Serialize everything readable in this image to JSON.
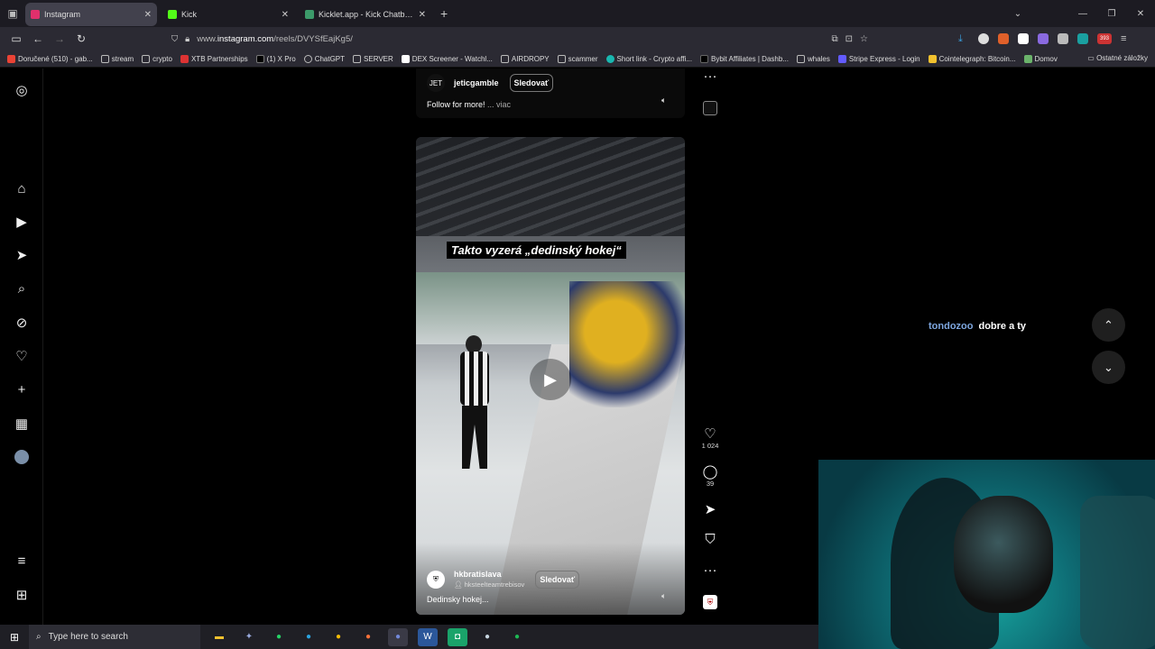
{
  "browser": {
    "tabs": [
      {
        "title": "Instagram",
        "active": true,
        "color": "#e1306c"
      },
      {
        "title": "Kick",
        "active": false,
        "color": "#53fc18"
      },
      {
        "title": "Kicklet.app - Kick Chatbot and C",
        "active": false,
        "color": "#3c9a6a"
      }
    ],
    "url_prefix": "www.",
    "url_host": "instagram.com",
    "url_path": "/reels/DVYSfEajKg5/",
    "extension_badge": "393"
  },
  "bookmarks": {
    "items": [
      "Doručené (510) - gab...",
      "stream",
      "crypto",
      "XTB Partnerships",
      "(1) X Pro",
      "ChatGPT",
      "SERVER",
      "DEX Screener - Watchl...",
      "AIRDROPY",
      "scammer",
      "Short link - Crypto affi...",
      "Bybit Affiliates | Dashb...",
      "whales",
      "Stripe Express - Login",
      "Cointelegraph: Bitcoin...",
      "Domov"
    ],
    "other": "Ostatné záložky"
  },
  "prev_reel": {
    "username": "jeticgamble",
    "avatar_text": "JET",
    "follow_label": "Sledovať",
    "description": "Follow for more!",
    "more_label": "... viac"
  },
  "reel": {
    "overlay_text": "Takto vyzerá „dedinský hokej“",
    "username": "hkbratislava",
    "collab": "hksteelteamtrebisov",
    "follow_label": "Sledovať",
    "description": "Dedinsky hokej..."
  },
  "actions": {
    "likes": "1 024",
    "comments": "39"
  },
  "chat": {
    "user": "tondozoo",
    "message": "dobre a ty"
  },
  "taskbar": {
    "search_placeholder": "Type here to search"
  }
}
